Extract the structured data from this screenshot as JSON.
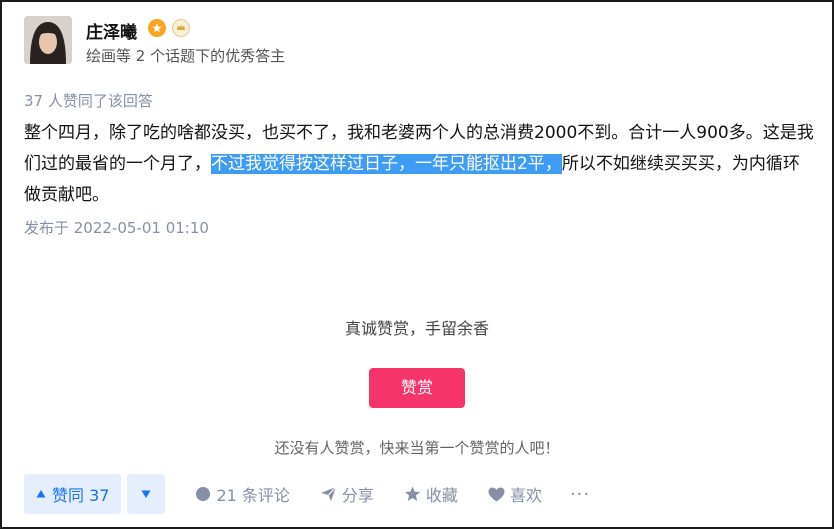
{
  "author": {
    "name": "庄泽曦",
    "description": "绘画等 2 个话题下的优秀答主",
    "badges": [
      "certified-badge-icon",
      "level-badge-icon"
    ]
  },
  "answer": {
    "upvote_info": "37 人赞同了该回答",
    "content_before": "整个四月，除了吃的啥都没买，也买不了，我和老婆两个人的总消费2000不到。合计一人900多。这是我们过的最省的一个月了，",
    "content_highlight": "不过我觉得按这样过日子，一年只能抠出2平，",
    "content_after": "所以不如继续买买买，为内循环做贡献吧。",
    "publish_time": "发布于 2022-05-01 01:10"
  },
  "reward": {
    "title": "真诚赞赏，手留余香",
    "button_label": "赞赏",
    "note": "还没有人赞赏，快来当第一个赞赏的人吧！"
  },
  "actions": {
    "upvote_label": "赞同 37",
    "comments_label": "21 条评论",
    "share_label": "分享",
    "favorite_label": "收藏",
    "like_label": "喜欢",
    "more_label": "···"
  },
  "colors": {
    "accent": "#1772f6",
    "highlight": "#3f9cf5",
    "reward": "#f4346b",
    "secondary_text": "#8590a6"
  }
}
